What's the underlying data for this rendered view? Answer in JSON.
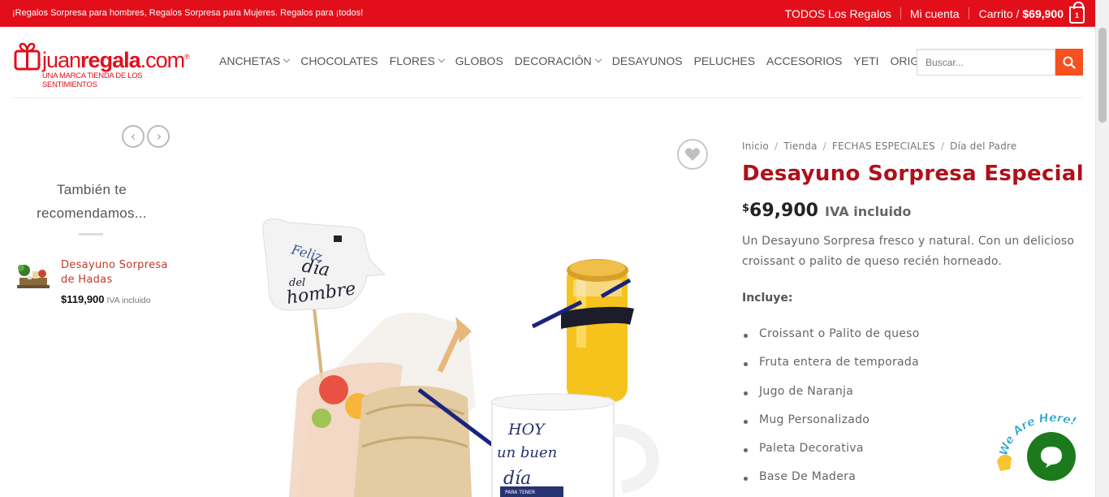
{
  "topbar": {
    "promo": "¡Regalos Sorpresa para hombres, Regalos Sorpresa para Mujeres. Regalos para ¡todos!",
    "all_gifts": "TODOS Los Regalos",
    "account": "Mi cuenta",
    "cart_label": "Carrito /",
    "cart_total": "$69,900",
    "cart_count": "1"
  },
  "logo": {
    "word_a": "juan",
    "word_b": "regala",
    "word_c": ".com",
    "reg": "®",
    "tagline": "UNA MARCA TIENDA DE LOS SENTIMIENTOS"
  },
  "nav": [
    {
      "label": "ANCHETAS",
      "dropdown": true
    },
    {
      "label": "CHOCOLATES",
      "dropdown": false
    },
    {
      "label": "FLORES",
      "dropdown": true
    },
    {
      "label": "GLOBOS",
      "dropdown": false
    },
    {
      "label": "DECORACIÓN",
      "dropdown": true
    },
    {
      "label": "DESAYUNOS",
      "dropdown": false
    },
    {
      "label": "PELUCHES",
      "dropdown": false
    },
    {
      "label": "ACCESORIOS",
      "dropdown": false
    },
    {
      "label": "YETI",
      "dropdown": false
    },
    {
      "label": "ORIGINAL",
      "dropdown": true
    }
  ],
  "search": {
    "placeholder": "Buscar..."
  },
  "sidebar": {
    "title": "También te recomendamos...",
    "items": [
      {
        "name": "Desayuno Sorpresa de Hadas",
        "price": "$119,900",
        "tax": "IVA incluido"
      }
    ]
  },
  "image_art": {
    "card_line1": "Feliz",
    "card_line2": "día",
    "card_line3": "del",
    "card_line4": "hombre",
    "mug_line1": "HOY",
    "mug_line2": "un buen",
    "mug_line3": "día",
    "mug_line4": "PARA TENER"
  },
  "product": {
    "breadcrumbs": [
      "Inicio",
      "Tienda",
      "FECHAS ESPECIALES",
      "Día del Padre"
    ],
    "breadcrumb_sep": "/",
    "title": "Desayuno Sorpresa Especial",
    "currency": "$",
    "price": "69,900",
    "tax": "IVA incluido",
    "description": "Un Desayuno Sorpresa fresco y natural. Con un delicioso croissant o palito de queso recién horneado.",
    "includes_label": "Incluye:",
    "includes": [
      "Croissant o Palito de queso",
      "Fruta entera de temporada",
      "Jugo de Naranja",
      "Mug Personalizado",
      "Paleta Decorativa",
      "Base De Madera"
    ]
  },
  "chat": {
    "label": "We Are Here!"
  },
  "colors": {
    "brand_red": "#e20f1b",
    "title_red": "#b0101a",
    "search_orange": "#f4511e",
    "chat_green": "#1b7a1b"
  }
}
